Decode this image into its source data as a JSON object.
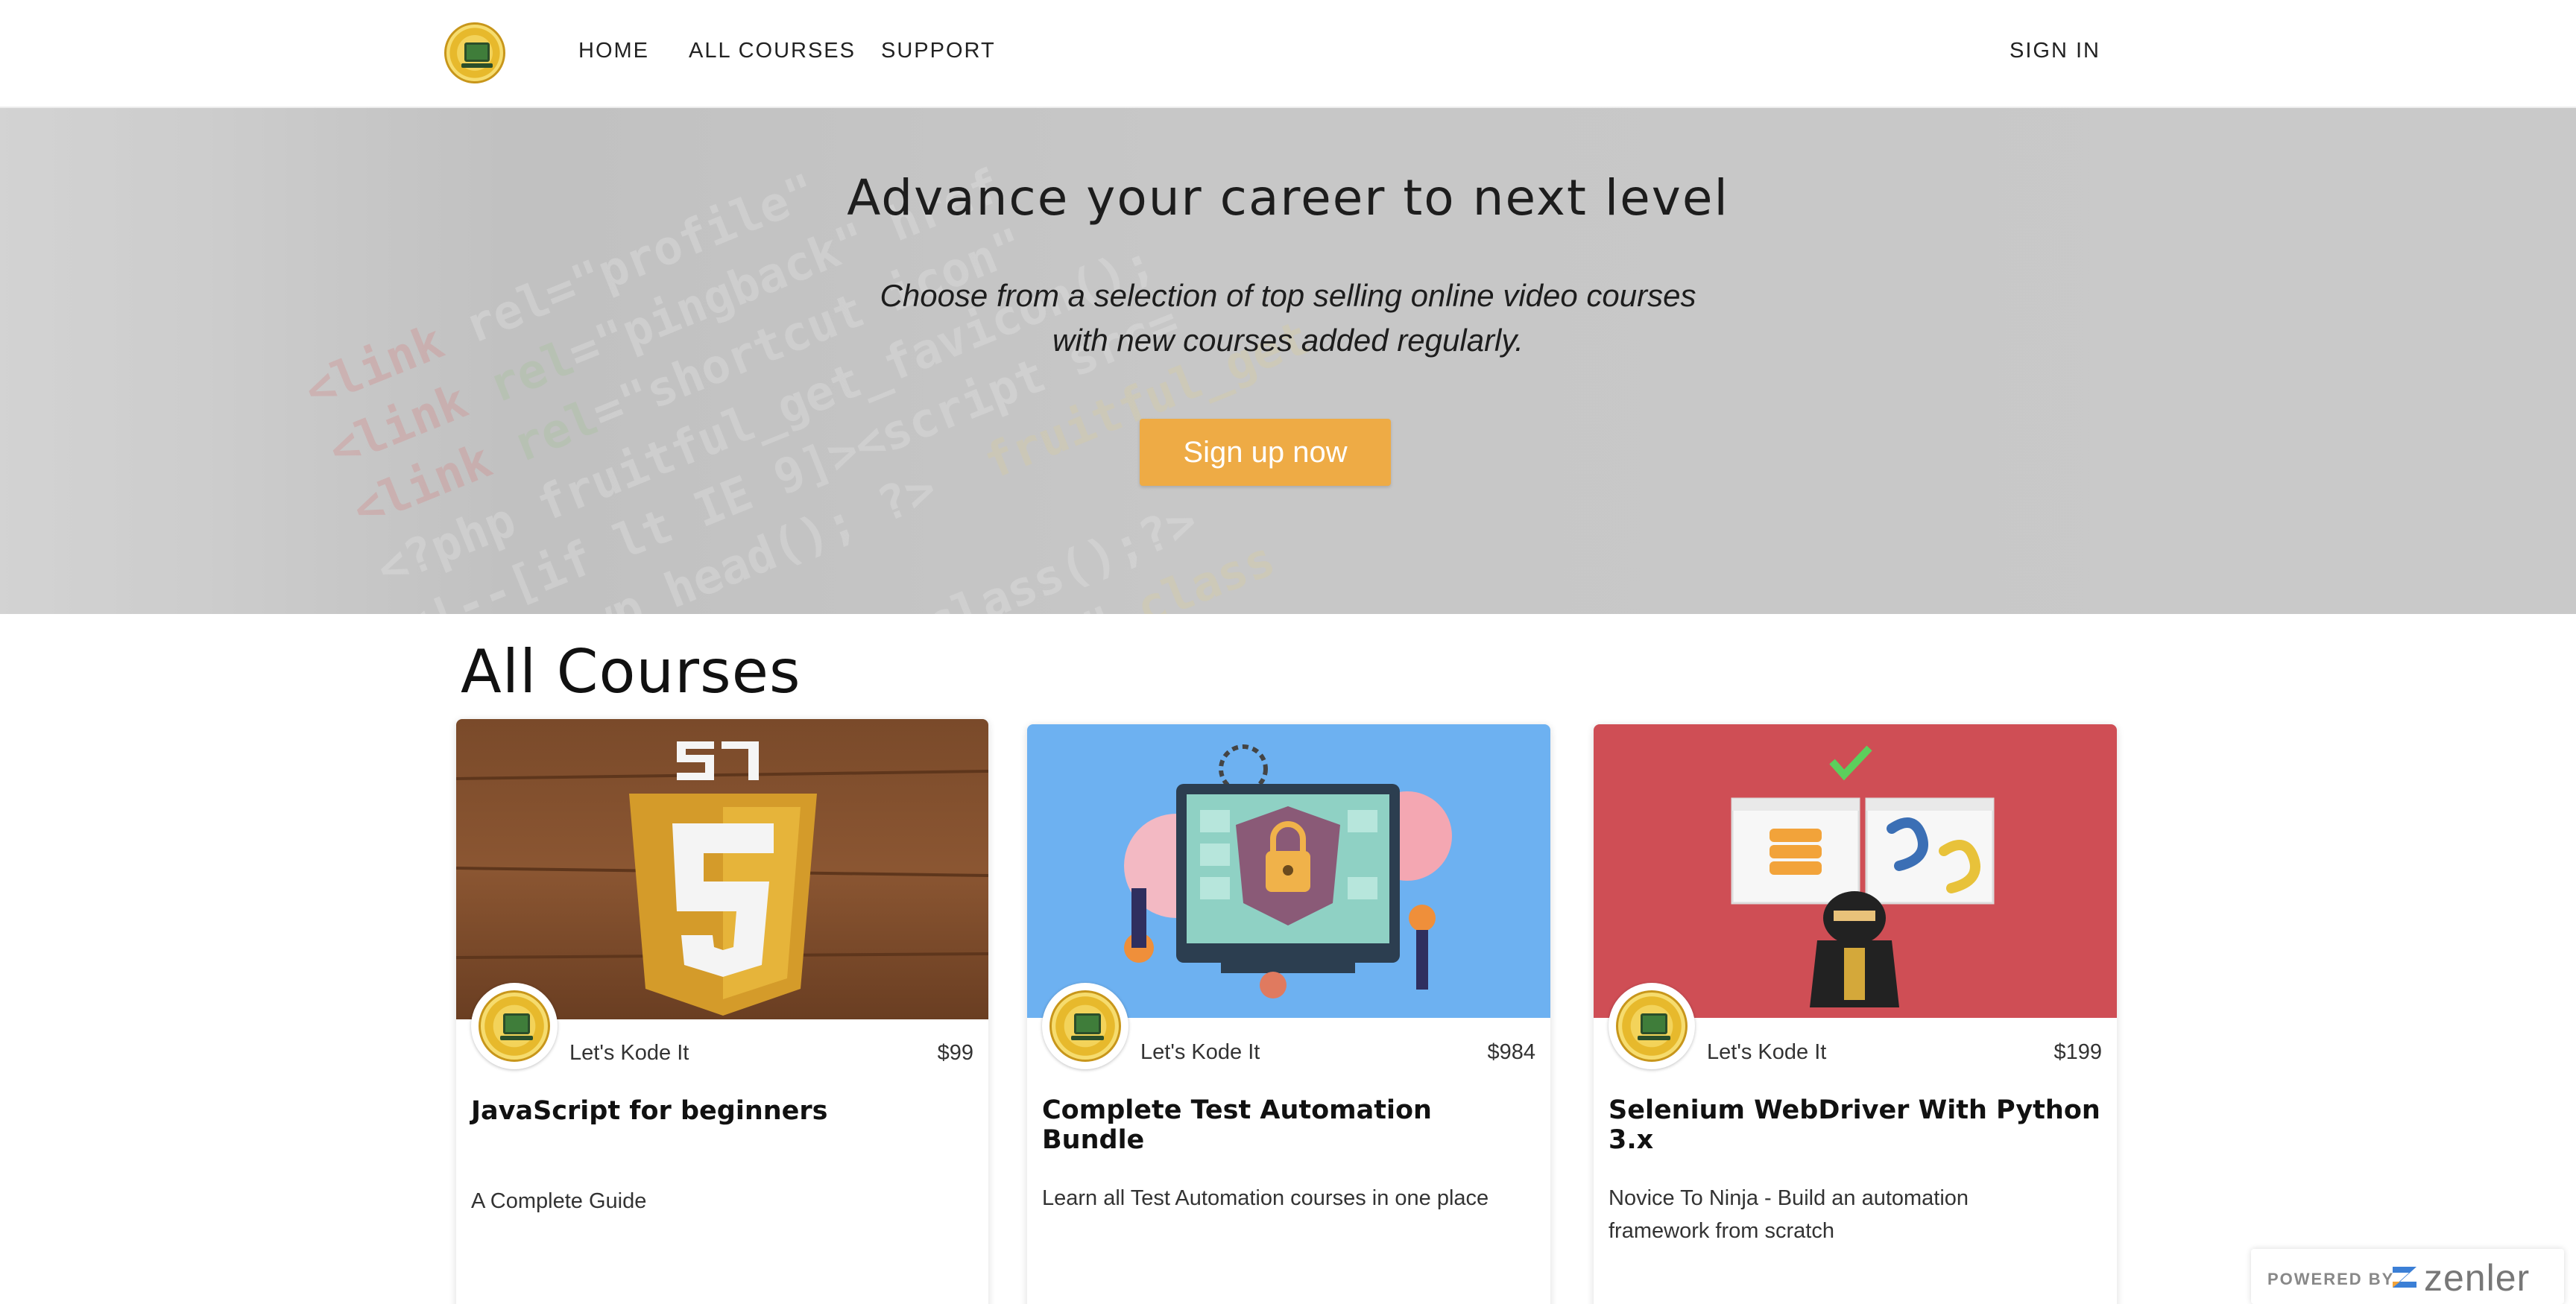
{
  "nav": {
    "logo_alt": "Let's Kode It",
    "links": [
      "HOME",
      "ALL COURSES",
      "SUPPORT"
    ],
    "sign_in": "SIGN IN"
  },
  "hero": {
    "title": "Advance your career to next level",
    "subtitle_line1": "Choose from a selection of top selling online video courses",
    "subtitle_line2": "with new courses added regularly.",
    "cta": "Sign up now",
    "cta_color": "#eeab45"
  },
  "courses_section": {
    "title": "All Courses",
    "items": [
      {
        "author": "Let's Kode It",
        "price": "$99",
        "title": "JavaScript for beginners",
        "description": "A Complete Guide",
        "thumb_icon": "javascript-shield-icon"
      },
      {
        "author": "Let's Kode It",
        "price": "$984",
        "title": "Complete Test Automation Bundle",
        "description": "Learn all Test Automation courses in one place",
        "thumb_icon": "security-lock-illustration"
      },
      {
        "author": "Let's Kode It",
        "price": "$199",
        "title": "Selenium WebDriver With Python 3.x",
        "description": "Novice To Ninja - Build an automation framework from scratch",
        "thumb_icon": "ninja-python-illustration"
      }
    ]
  },
  "badge": {
    "powered_by": "POWERED BY",
    "brand": "zenler"
  }
}
